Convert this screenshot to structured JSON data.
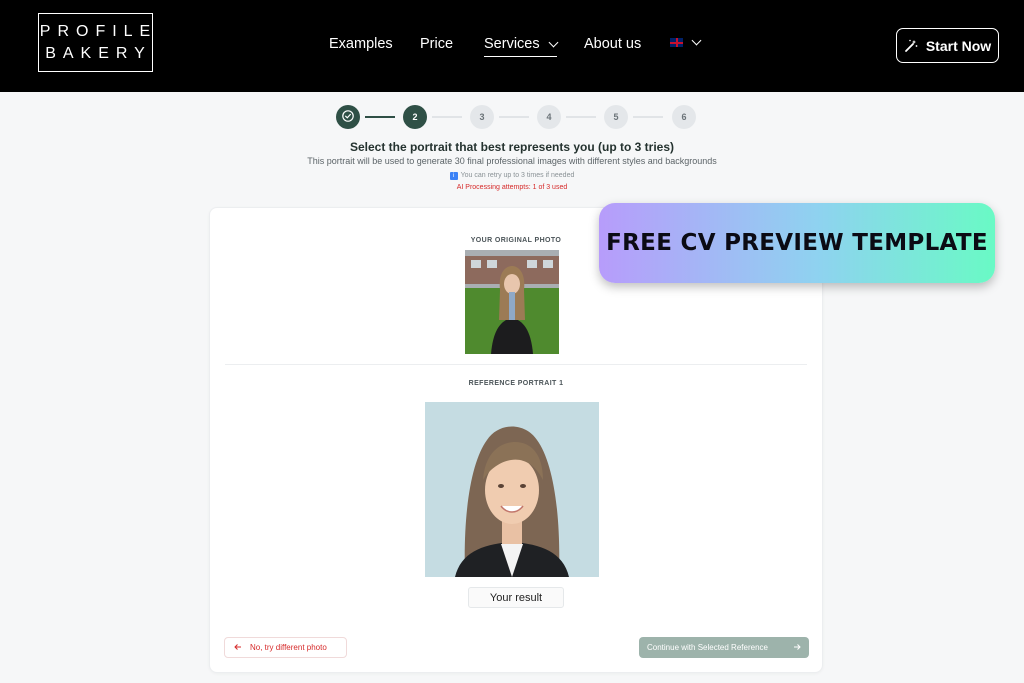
{
  "header": {
    "logo_line1": "PROFILE",
    "logo_line2": "BAKERY",
    "nav": {
      "examples": "Examples",
      "price": "Price",
      "services": "Services",
      "about": "About us"
    },
    "start_button": "Start Now"
  },
  "stepper": {
    "steps": [
      "2",
      "3",
      "4",
      "5",
      "6"
    ],
    "current_step": 2
  },
  "main": {
    "heading": "Select the portrait that best represents you (up to 3 tries)",
    "subheading": "This portrait will be used to generate 30 final professional images with different styles and backgrounds",
    "retry_note": "You can retry up to 3 times if needed",
    "attempts": "AI Processing attempts: 1 of 3 used",
    "original_label": "YOUR ORIGINAL PHOTO",
    "reference_label": "REFERENCE PORTRAIT 1",
    "result_chip": "Your result",
    "retry_button": "No, try different photo",
    "continue_button": "Continue with Selected Reference"
  },
  "banner": {
    "text": "FREE CV PREVIEW TEMPLATE"
  },
  "colors": {
    "accent": "#2f5046",
    "error": "#d62a2a",
    "continue_disabled": "#9db3ab"
  }
}
